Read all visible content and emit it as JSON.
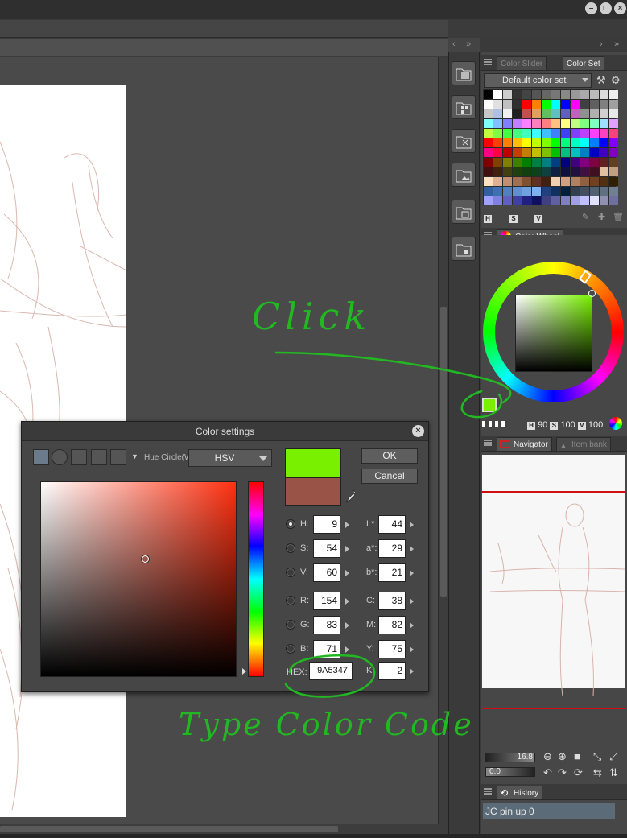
{
  "right_panel": {
    "color_slider_tab": "Color Slider",
    "color_set_tab": "Color Set",
    "color_set_name": "Default color set",
    "color_wheel_tab": "Color Wheel",
    "hsv_readout": {
      "h_label": "H",
      "h": "90",
      "s_label": "S",
      "s": "100",
      "v_label": "V",
      "v": "100"
    },
    "navigator_tab": "Navigator",
    "item_bank_tab": "Item bank",
    "zoom": "16.8",
    "rotation": "0.0",
    "history_tab": "History",
    "history_item": "JC pin up 0",
    "mini_labels": [
      "H",
      "S",
      "V"
    ]
  },
  "dialog": {
    "title": "Color settings",
    "hue_label": "Hue Circle(W",
    "mode": "HSV",
    "ok": "OK",
    "cancel": "Cancel",
    "current_color": "#78F000",
    "previous_color": "#9A5347",
    "fields_left": [
      {
        "label": "H:",
        "value": "9",
        "selected": true
      },
      {
        "label": "S:",
        "value": "54",
        "selected": false
      },
      {
        "label": "V:",
        "value": "60",
        "selected": false
      },
      {
        "label": "R:",
        "value": "154",
        "selected": false
      },
      {
        "label": "G:",
        "value": "83",
        "selected": false
      },
      {
        "label": "B:",
        "value": "71",
        "selected": false
      }
    ],
    "fields_right": [
      {
        "label": "L*:",
        "value": "44"
      },
      {
        "label": "a*:",
        "value": "29"
      },
      {
        "label": "b*:",
        "value": "21"
      },
      {
        "label": "C:",
        "value": "38"
      },
      {
        "label": "M:",
        "value": "82"
      },
      {
        "label": "Y:",
        "value": "75"
      },
      {
        "label": "K:",
        "value": "2"
      }
    ],
    "hex_label": "HEX:",
    "hex_value": "9A5347"
  },
  "annotations": {
    "click": "Click",
    "type": "Type Color Code"
  },
  "colors": {
    "main_color": "#78F000",
    "sub_color": "#2A2A2A",
    "annotation": "#22B822",
    "nav_frame": "#D01010"
  },
  "swatches": [
    "#000000",
    "#ffffff",
    "#cccccc",
    "#333333",
    "#444444",
    "#555555",
    "#666666",
    "#777777",
    "#888888",
    "#999999",
    "#aaaaaa",
    "#bbbbbb",
    "#dddddd",
    "#eeeeee",
    "#ffffff",
    "#e0e0e0",
    "#c0c0c0",
    "#303030",
    "#ff0000",
    "#ff8000",
    "#00ff00",
    "#00ffff",
    "#0000ff",
    "#ff00ff",
    "#404040",
    "#606060",
    "#808080",
    "#a0a0a0",
    "#c8c8c8",
    "#b0c0e0",
    "#f0f0f0",
    "#202020",
    "#c05050",
    "#e0a060",
    "#60c060",
    "#60c0c0",
    "#6060c0",
    "#c060c0",
    "#909090",
    "#b0b0b0",
    "#d0d0d0",
    "#e8e8e8",
    "#80ffff",
    "#80c0ff",
    "#8080ff",
    "#c080ff",
    "#ff80ff",
    "#ff80c0",
    "#ff8080",
    "#ffc080",
    "#ffff80",
    "#c0ff80",
    "#80ff80",
    "#80ffc0",
    "#a0e0ff",
    "#e0a0ff",
    "#c0ff40",
    "#80ff40",
    "#40ff40",
    "#40ff80",
    "#40ffc0",
    "#40ffff",
    "#40c0ff",
    "#4080ff",
    "#4040ff",
    "#8040ff",
    "#c040ff",
    "#ff40ff",
    "#ff40c0",
    "#ff4080",
    "#ff0000",
    "#ff4000",
    "#ff8000",
    "#ffc000",
    "#ffff00",
    "#c0ff00",
    "#80ff00",
    "#00ff00",
    "#00ff80",
    "#00ffc0",
    "#00ffff",
    "#0080ff",
    "#0000ff",
    "#8000ff",
    "#ff0080",
    "#ff0040",
    "#c00000",
    "#c04000",
    "#c08000",
    "#c0c000",
    "#80c000",
    "#00c000",
    "#00c080",
    "#00c0c0",
    "#0080c0",
    "#0000c0",
    "#4000c0",
    "#8000c0",
    "#800000",
    "#804000",
    "#808000",
    "#408000",
    "#008000",
    "#008040",
    "#008080",
    "#004080",
    "#000080",
    "#400080",
    "#800080",
    "#800040",
    "#602020",
    "#604020",
    "#401010",
    "#402010",
    "#404010",
    "#204010",
    "#104010",
    "#104020",
    "#104040",
    "#102040",
    "#101040",
    "#201040",
    "#401040",
    "#401020",
    "#e0c0a0",
    "#c0a080",
    "#ffe0c0",
    "#e0b090",
    "#c09070",
    "#a07050",
    "#805030",
    "#603020",
    "#402010",
    "#f0d0b0",
    "#d0a080",
    "#b08060",
    "#906040",
    "#704020",
    "#503010",
    "#302000",
    "#3060a0",
    "#4070b0",
    "#5080c0",
    "#6090d0",
    "#70a0e0",
    "#80b0f0",
    "#204080",
    "#103060",
    "#002040",
    "#304050",
    "#405060",
    "#506070",
    "#607080",
    "#708090",
    "#a0a0ff",
    "#8080e0",
    "#6060c0",
    "#4040a0",
    "#202080",
    "#101060",
    "#404080",
    "#6060a0",
    "#8080c0",
    "#a0a0e0",
    "#c0c0ff",
    "#e0e0ff",
    "#9090b0",
    "#7070a0"
  ]
}
